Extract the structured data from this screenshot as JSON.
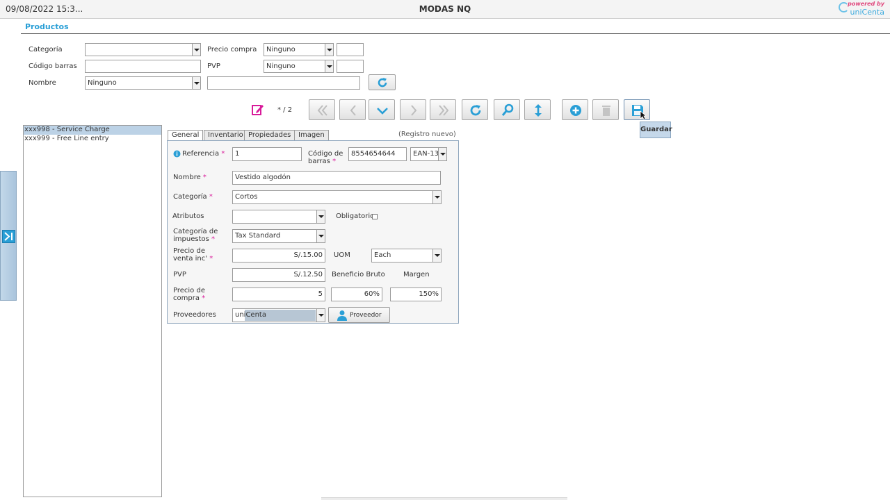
{
  "titlebar": {
    "datetime": "09/08/2022 15:3...",
    "title": "MODAS NQ",
    "logo_powered": "powered by",
    "logo_brand": "uniCenta"
  },
  "header": {
    "section_title": "Productos"
  },
  "filter": {
    "categoria_label": "Categoría",
    "categoria_value": "",
    "codigo_barras_label": "Código barras",
    "codigo_barras_value": "",
    "nombre_label": "Nombre",
    "nombre_op": "Ninguno",
    "nombre_value": "",
    "precio_compra_label": "Precio compra",
    "precio_compra_op": "Ninguno",
    "precio_compra_value": "",
    "pvp_label": "PVP",
    "pvp_op": "Ninguno",
    "pvp_value": ""
  },
  "toolbar": {
    "record_counter": "* / 2",
    "tooltip": "Guardar"
  },
  "list": {
    "items": [
      {
        "label": "xxx998 - Service Charge"
      },
      {
        "label": "xxx999 - Free Line entry"
      }
    ]
  },
  "tabs": {
    "general": "General",
    "inventario": "Inventario",
    "propiedades": "Propiedades",
    "imagen": "Imagen",
    "status": "(Registro nuevo)"
  },
  "form": {
    "referencia_label": "Referencia",
    "referencia_value": "1",
    "codigo_barras_label_1": "Código de",
    "codigo_barras_label_2": "barras",
    "codigo_barras_value": "8554654644",
    "barcode_type": "EAN-13",
    "nombre_label": "Nombre",
    "nombre_value": "Vestido algodón",
    "categoria_label": "Categoría",
    "categoria_value": "Cortos",
    "atributos_label": "Atributos",
    "atributos_value": "",
    "obligatorio_label": "Obligatorio",
    "cat_impuestos_label_1": "Categoría de",
    "cat_impuestos_label_2": "impuestos",
    "cat_impuestos_value": "Tax Standard",
    "precio_venta_label_1": "Precio de",
    "precio_venta_label_2": "venta inc'",
    "precio_venta_value": "S/.15.00",
    "uom_label": "UOM",
    "uom_value": "Each",
    "pvp_label": "PVP",
    "pvp_value": "S/.12.50",
    "beneficio_label": "Beneficio Bruto",
    "margen_label": "Margen",
    "precio_compra_label_1": "Precio de",
    "precio_compra_label_2": "compra",
    "precio_compra_value": "5",
    "beneficio_value": "60%",
    "margen_value": "150%",
    "proveedores_label": "Proveedores",
    "proveedores_value": "uniCenta",
    "proveedor_button": "Proveedor",
    "required_mark": "*"
  },
  "colors": {
    "accent": "#2a9fd6",
    "required": "#d81b9a",
    "selection": "#bcd2e6"
  }
}
